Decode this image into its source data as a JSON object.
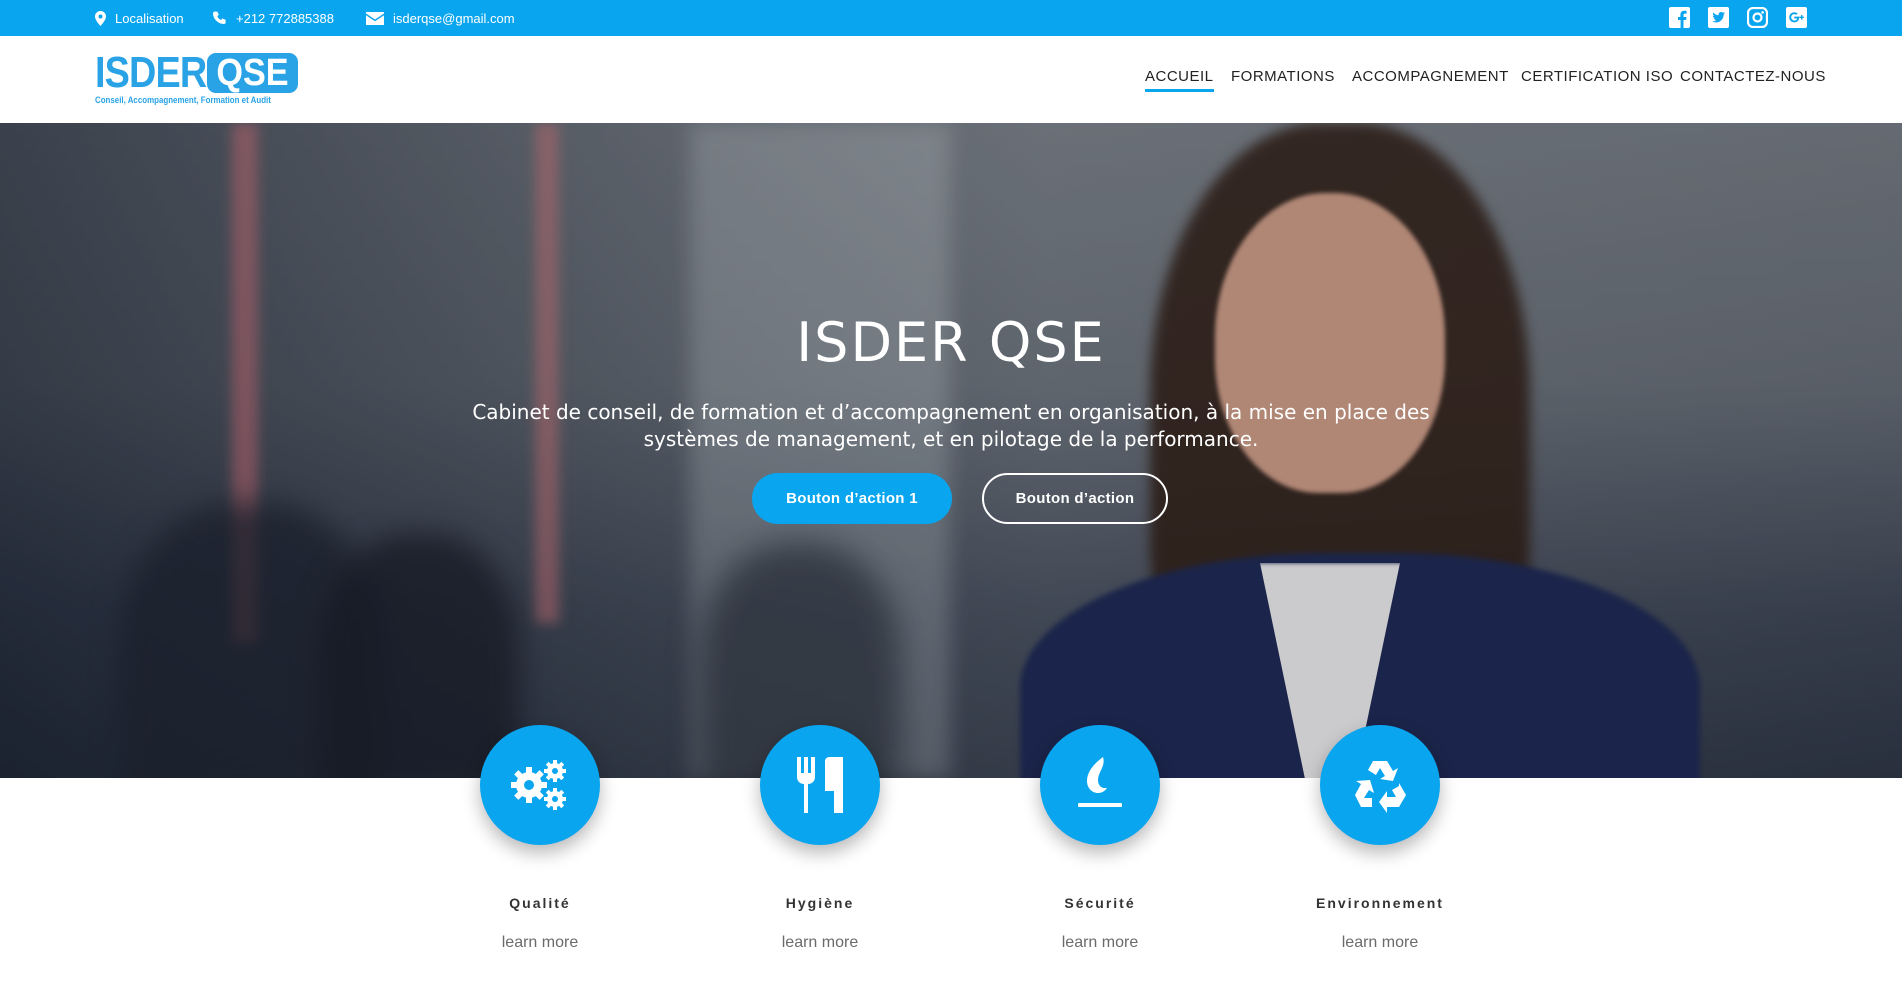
{
  "topbar": {
    "location_label": "Localisation",
    "phone": "+212 772885388",
    "email": "isderqse@gmail.com",
    "social_icons": [
      "facebook-icon",
      "twitter-icon",
      "instagram-icon",
      "google-plus-icon"
    ]
  },
  "logo": {
    "main": "ISDER",
    "badge": "QSE",
    "tagline": "Conseil, Accompagnement, Formation et Audit"
  },
  "nav": {
    "items": [
      {
        "label": "ACCUEIL",
        "active": true
      },
      {
        "label": "FORMATIONS",
        "active": false
      },
      {
        "label": "ACCOMPAGNEMENT",
        "active": false
      },
      {
        "label": "CERTIFICATION ISO",
        "active": false
      },
      {
        "label": "CONTACTEZ-NOUS",
        "active": false
      }
    ]
  },
  "hero": {
    "title": "ISDER QSE",
    "subtitle": "Cabinet de conseil, de formation et d’accompagnement en organisation, à la mise en place des systèmes de management,  et en pilotage de la performance.",
    "primary_button": "Bouton d’action 1",
    "secondary_button": "Bouton d’action"
  },
  "features": [
    {
      "icon": "gears-icon",
      "title": "Qualité",
      "link": "learn more"
    },
    {
      "icon": "utensils-icon",
      "title": "Hygiène",
      "link": "learn more"
    },
    {
      "icon": "fire-icon",
      "title": "Sécurité",
      "link": "learn more"
    },
    {
      "icon": "recycle-icon",
      "title": "Environnement",
      "link": "learn more"
    }
  ],
  "colors": {
    "accent": "#0aa5ef",
    "logo_blue": "#2aa3e6",
    "nav_text": "#222222",
    "muted_text": "#6a6a6a"
  }
}
